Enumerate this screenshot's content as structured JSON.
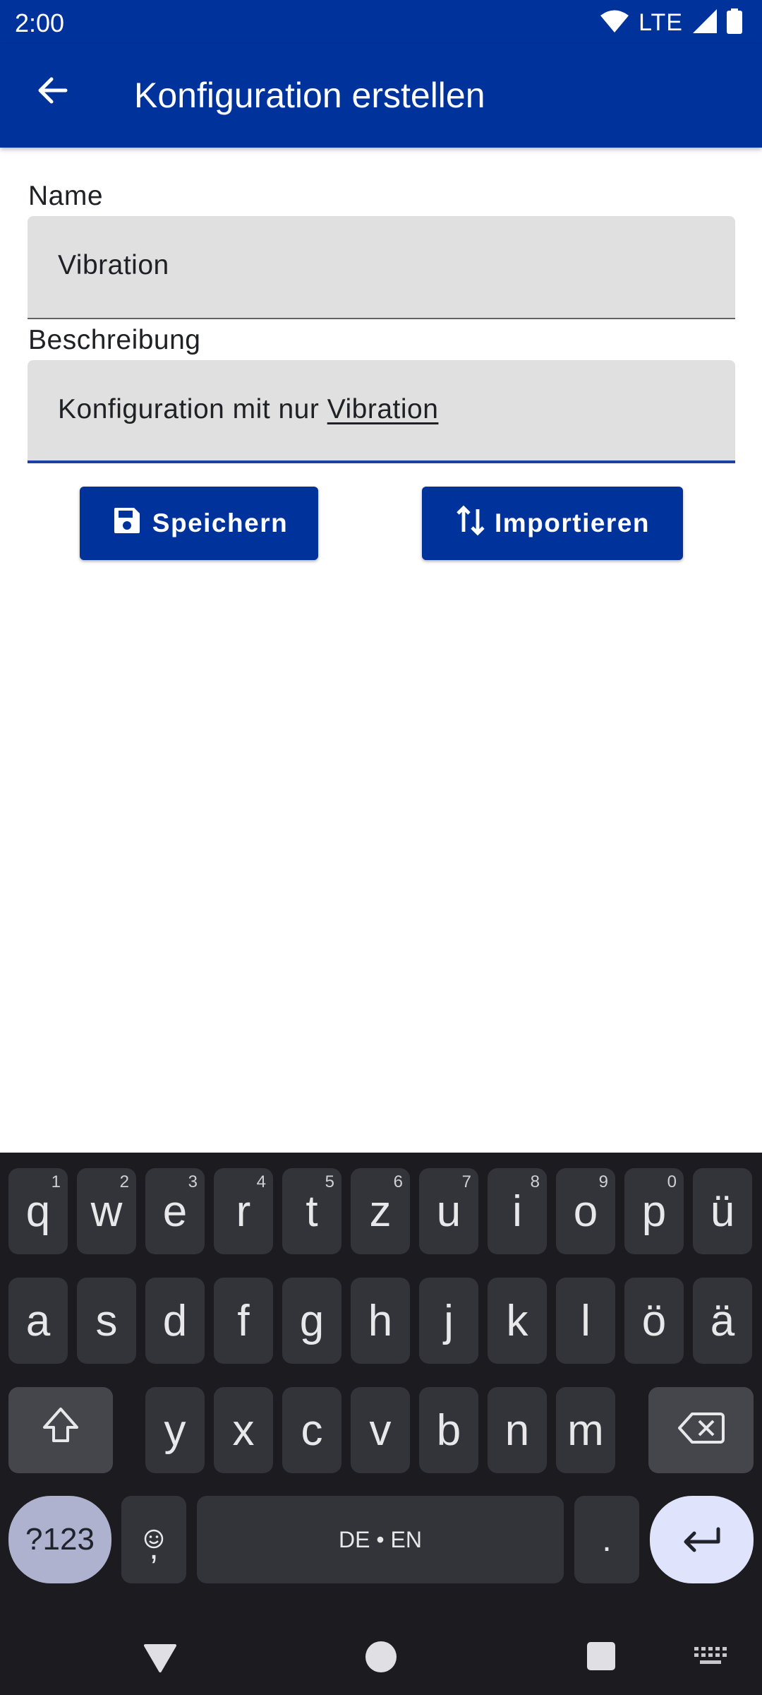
{
  "status_bar": {
    "time": "2:00",
    "network": "LTE"
  },
  "app_bar": {
    "title": "Konfiguration erstellen"
  },
  "form": {
    "name_label": "Name",
    "name_value": "Vibration",
    "description_label": "Beschreibung",
    "description_value_plain": "Konfiguration mit nur ",
    "description_value_composing": "Vibration"
  },
  "buttons": {
    "save": "Speichern",
    "import": "Importieren"
  },
  "keyboard": {
    "row1": [
      {
        "key": "q",
        "hint": "1"
      },
      {
        "key": "w",
        "hint": "2"
      },
      {
        "key": "e",
        "hint": "3"
      },
      {
        "key": "r",
        "hint": "4"
      },
      {
        "key": "t",
        "hint": "5"
      },
      {
        "key": "z",
        "hint": "6"
      },
      {
        "key": "u",
        "hint": "7"
      },
      {
        "key": "i",
        "hint": "8"
      },
      {
        "key": "o",
        "hint": "9"
      },
      {
        "key": "p",
        "hint": "0"
      },
      {
        "key": "ü",
        "hint": ""
      }
    ],
    "row2": [
      "a",
      "s",
      "d",
      "f",
      "g",
      "h",
      "j",
      "k",
      "l",
      "ö",
      "ä"
    ],
    "row3": [
      "y",
      "x",
      "c",
      "v",
      "b",
      "n",
      "m"
    ],
    "symbols_key": "?123",
    "comma_key": ",",
    "space_label": "DE • EN",
    "period_key": "."
  },
  "colors": {
    "primary": "#00329c",
    "field_bg": "#e0e0e0",
    "keyboard_bg": "#1c1b1f",
    "key_bg": "#333439"
  },
  "icons": [
    "back-arrow-icon",
    "save-icon",
    "swap-vertical-icon",
    "wifi-icon",
    "signal-icon",
    "battery-icon",
    "shift-icon",
    "backspace-icon",
    "emoji-icon",
    "enter-icon",
    "nav-back-icon",
    "nav-home-icon",
    "nav-recents-icon",
    "keyboard-switch-icon"
  ]
}
